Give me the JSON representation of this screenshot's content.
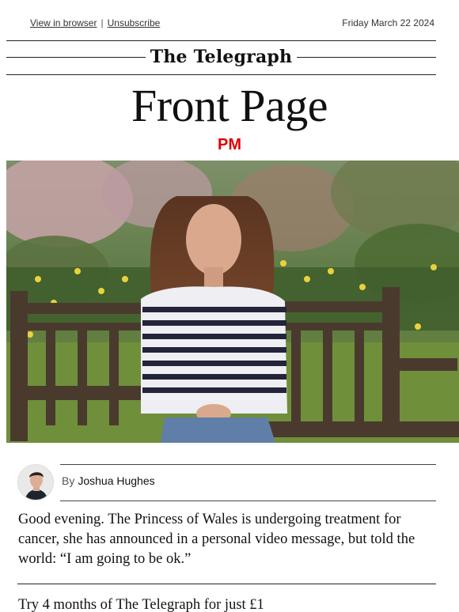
{
  "header": {
    "view_in_browser": "View in browser",
    "separator": "|",
    "unsubscribe": "Unsubscribe",
    "date": "Friday March 22 2024"
  },
  "masthead": {
    "logo": "The Telegraph"
  },
  "title": "Front Page",
  "edition": "PM",
  "hero": {
    "icon": "hero-photo"
  },
  "byline": {
    "prefix": "By",
    "author": "Joshua Hughes"
  },
  "lede": "Good evening. The Princess of Wales is undergoing treatment for cancer, she has announced in a personal video message, but told the world: “I am going to be ok.”",
  "promo": "Try 4 months of The Telegraph for just £1",
  "colors": {
    "accent": "#e00000",
    "text": "#111111",
    "rule": "#222222"
  }
}
